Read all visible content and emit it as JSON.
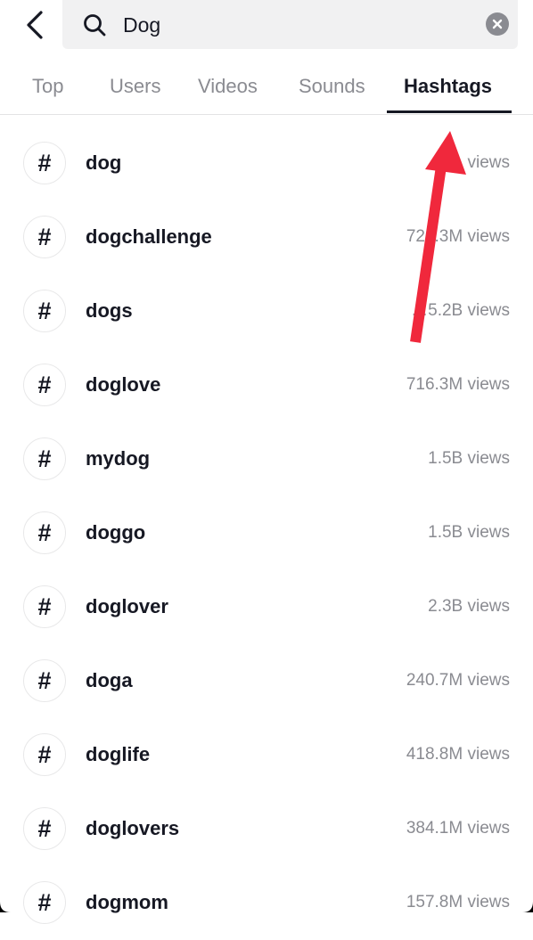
{
  "header": {
    "back_icon": "chevron-left-icon",
    "search": {
      "icon": "search-icon",
      "value": "Dog",
      "clear_icon": "clear-icon"
    }
  },
  "tabs": [
    {
      "label": "Top",
      "active": false
    },
    {
      "label": "Users",
      "active": false
    },
    {
      "label": "Videos",
      "active": false
    },
    {
      "label": "Sounds",
      "active": false
    },
    {
      "label": "Hashtags",
      "active": true
    }
  ],
  "hashtags": [
    {
      "name": "dog",
      "views": "1… views"
    },
    {
      "name": "dogchallenge",
      "views": "724.3M views"
    },
    {
      "name": "dogs",
      "views": "…5.2B views"
    },
    {
      "name": "doglove",
      "views": "716.3M views"
    },
    {
      "name": "mydog",
      "views": "1.5B views"
    },
    {
      "name": "doggo",
      "views": "1.5B views"
    },
    {
      "name": "doglover",
      "views": "2.3B views"
    },
    {
      "name": "doga",
      "views": "240.7M views"
    },
    {
      "name": "doglife",
      "views": "418.8M views"
    },
    {
      "name": "doglovers",
      "views": "384.1M views"
    },
    {
      "name": "dogmom",
      "views": "157.8M views"
    }
  ],
  "hash_symbol": "#",
  "annotation": {
    "type": "arrow",
    "color": "#f0283c",
    "points_to": "tab-hashtags"
  },
  "colors": {
    "text_primary": "#161823",
    "text_secondary": "#8a8b91",
    "search_bg": "#f1f1f2",
    "accent_arrow": "#f0283c"
  }
}
